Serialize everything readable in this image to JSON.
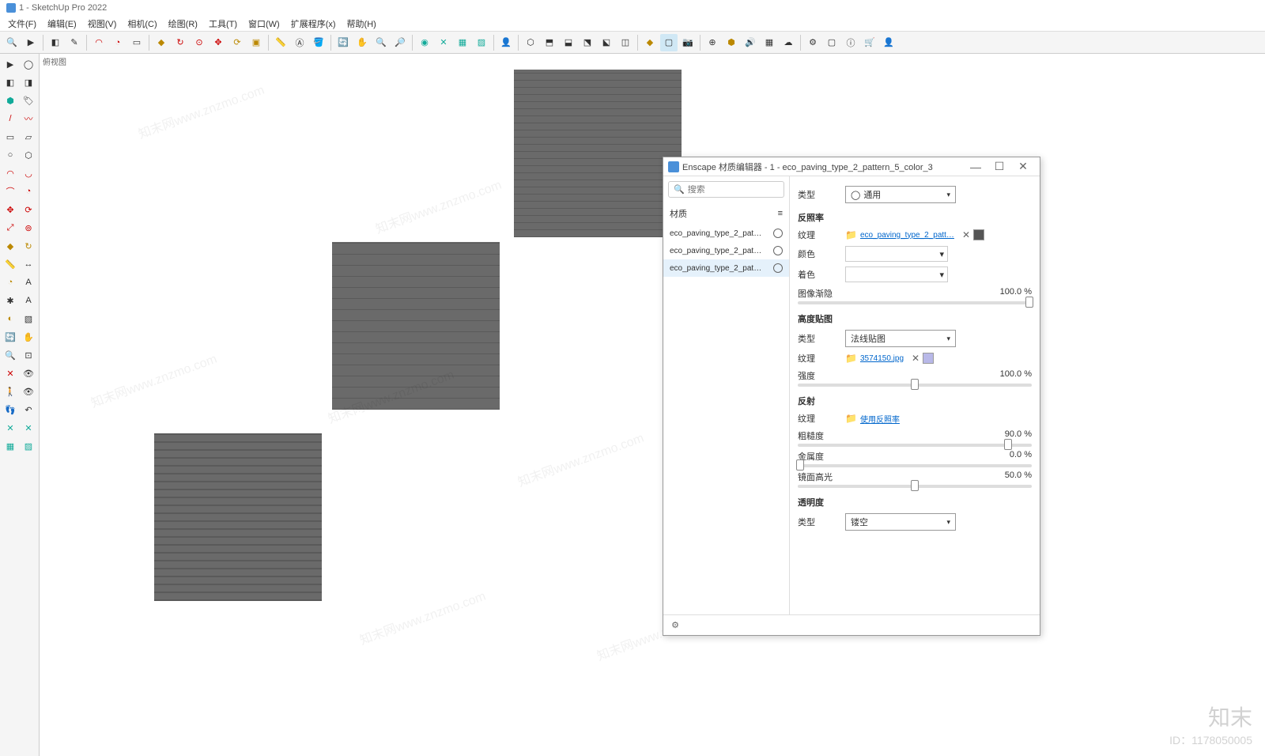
{
  "app": {
    "title": "1 - SketchUp Pro 2022"
  },
  "menu": [
    "文件(F)",
    "编辑(E)",
    "视图(V)",
    "相机(C)",
    "绘图(R)",
    "工具(T)",
    "窗口(W)",
    "扩展程序(x)",
    "帮助(H)"
  ],
  "viewport": {
    "label": "俯视图"
  },
  "enscape": {
    "title": "Enscape 材质编辑器 - 1 - eco_paving_type_2_pattern_5_color_3",
    "search_placeholder": "搜索",
    "materials_label": "材质",
    "materials": [
      {
        "name": "eco_paving_type_2_pat…",
        "selected": false
      },
      {
        "name": "eco_paving_type_2_pat…",
        "selected": false
      },
      {
        "name": "eco_paving_type_2_pat…",
        "selected": true
      }
    ],
    "type_label": "类型",
    "type_value": "通用",
    "sections": {
      "albedo": {
        "title": "反照率",
        "texture_label": "纹理",
        "texture_file": "eco_paving_type_2_patt…",
        "color_label": "颜色",
        "tint_label": "着色",
        "fade_label": "图像渐隐",
        "fade_value": "100.0 %"
      },
      "height": {
        "title": "高度贴图",
        "type_label": "类型",
        "type_value": "法线贴图",
        "texture_label": "纹理",
        "texture_file": "3574150.jpg",
        "intensity_label": "强度",
        "intensity_value": "100.0 %"
      },
      "reflect": {
        "title": "反射",
        "texture_label": "纹理",
        "use_albedo": "使用反照率",
        "roughness_label": "粗糙度",
        "roughness_value": "90.0 %",
        "metallic_label": "金属度",
        "metallic_value": "0.0 %",
        "specular_label": "镜面高光",
        "specular_value": "50.0 %"
      },
      "transparency": {
        "title": "透明度",
        "type_label": "类型",
        "type_value": "镂空"
      }
    }
  },
  "watermark": {
    "brand": "知末",
    "id": "ID：1178050005",
    "diag": "知末网www.znzmo.com"
  },
  "swatch_colors": {
    "albedo": "#555555",
    "normal": "#b8b8e8"
  }
}
